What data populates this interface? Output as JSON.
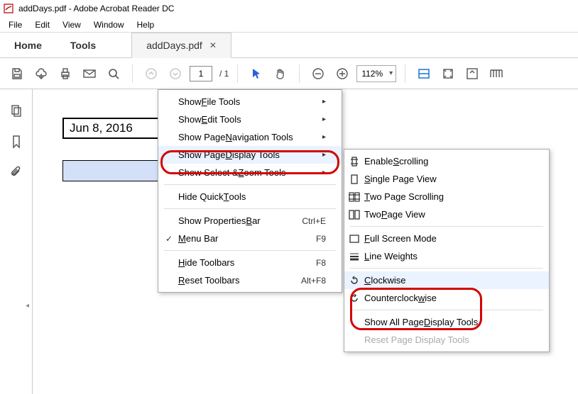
{
  "app": {
    "title": "addDays.pdf - Adobe Acrobat Reader DC"
  },
  "menubar": {
    "file": "File",
    "edit": "Edit",
    "view": "View",
    "window": "Window",
    "help": "Help"
  },
  "tabs": {
    "home": "Home",
    "tools": "Tools",
    "doc": "addDays.pdf"
  },
  "toolbar": {
    "page_value": "1",
    "page_total": "/ 1",
    "zoom_value": "112%"
  },
  "document": {
    "date_text": "Jun 8, 2016"
  },
  "menu1": {
    "show_file": {
      "pre": "Show ",
      "u": "F",
      "post": "ile Tools"
    },
    "show_edit": {
      "pre": "Show ",
      "u": "E",
      "post": "dit Tools"
    },
    "show_nav": {
      "pre": "Show Page ",
      "u": "N",
      "post": "avigation Tools"
    },
    "show_disp": {
      "pre": "Show Page ",
      "u": "D",
      "post": "isplay Tools"
    },
    "show_zoom": {
      "pre": "Show Select & ",
      "u": "Z",
      "post": "oom Tools"
    },
    "hide_quick": {
      "pre": "Hide Quick ",
      "u": "T",
      "post": "ools"
    },
    "props_bar": {
      "pre": "Show Properties ",
      "u": "B",
      "post": "ar",
      "sc": "Ctrl+E"
    },
    "menu_bar": {
      "pre": "",
      "u": "M",
      "post": "enu Bar",
      "sc": "F9"
    },
    "hide_tb": {
      "pre": "",
      "u": "H",
      "post": "ide Toolbars",
      "sc": "F8"
    },
    "reset_tb": {
      "pre": "",
      "u": "R",
      "post": "eset Toolbars",
      "sc": "Alt+F8"
    }
  },
  "menu2": {
    "scroll": {
      "pre": "Enable ",
      "u": "S",
      "post": "crolling"
    },
    "single": {
      "pre": "",
      "u": "S",
      "post": "ingle Page View"
    },
    "twoscroll": {
      "pre": "",
      "u": "T",
      "post": "wo Page Scrolling"
    },
    "twopage": {
      "pre": "Two ",
      "u": "P",
      "post": "age View"
    },
    "full": {
      "pre": "",
      "u": "F",
      "post": "ull Screen Mode"
    },
    "linew": {
      "pre": "",
      "u": "L",
      "post": "ine Weights"
    },
    "cw": {
      "pre": "",
      "u": "C",
      "post": "lockwise"
    },
    "ccw": {
      "pre": "Counterclock",
      "u": "w",
      "post": "ise"
    },
    "showall": {
      "pre": "Show All Page ",
      "u": "D",
      "post": "isplay Tools"
    },
    "reset": {
      "text": "Reset Page Display Tools"
    }
  }
}
